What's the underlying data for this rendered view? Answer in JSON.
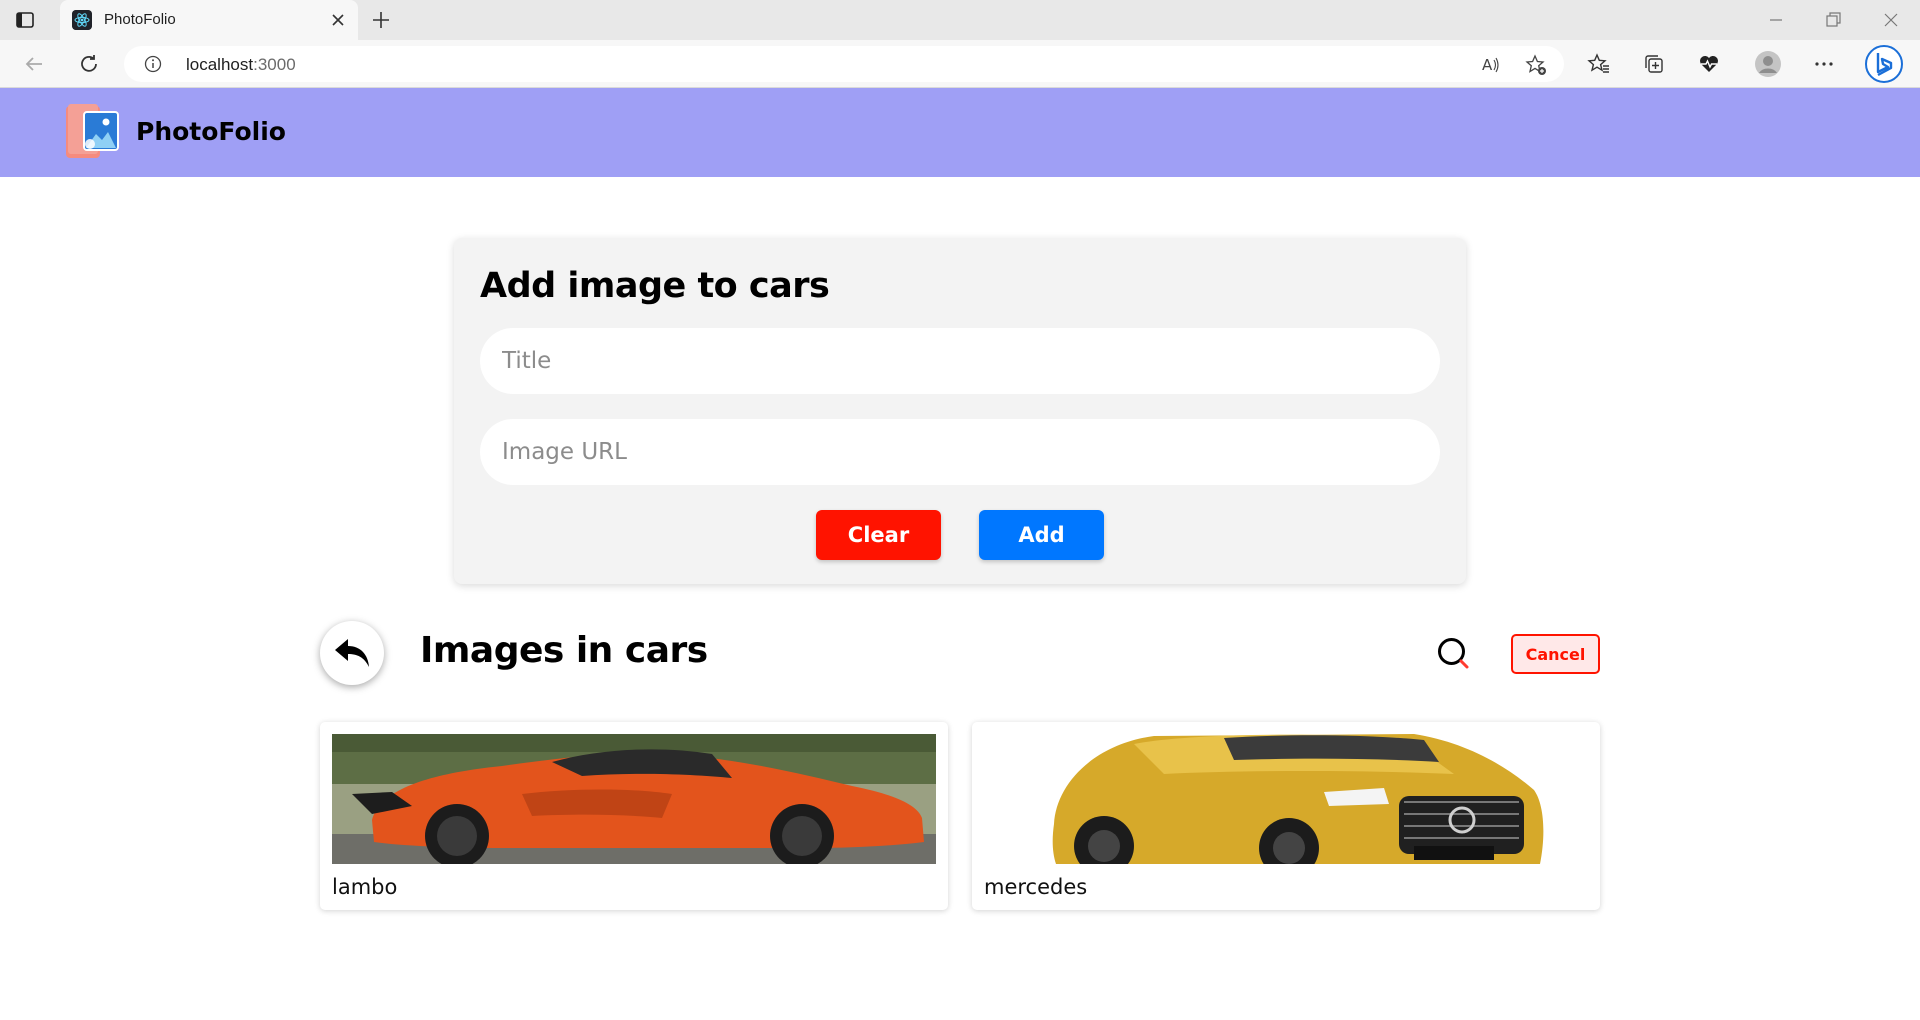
{
  "browser": {
    "tab_title": "PhotoFolio",
    "url_host": "localhost",
    "url_port": ":3000",
    "icons": [
      "sidebar-icon",
      "react-favicon-icon",
      "close-icon",
      "plus-icon",
      "minimize-icon",
      "restore-icon",
      "back-arrow-icon",
      "reload-icon",
      "info-icon",
      "read-aloud-icon",
      "add-favorite-icon",
      "favorites-icon",
      "collections-icon",
      "health-icon",
      "profile-icon",
      "more-icon",
      "bing-icon"
    ]
  },
  "header": {
    "title": "PhotoFolio",
    "bg_color": "#9f9ff5"
  },
  "form": {
    "heading": "Add image to cars",
    "title_placeholder": "Title",
    "url_placeholder": "Image URL",
    "clear_label": "Clear",
    "add_label": "Add",
    "clear_color": "#ff1300",
    "add_color": "#0077ff"
  },
  "images_section": {
    "title": "Images in cars",
    "cancel_label": "Cancel",
    "items": [
      {
        "caption": "lambo",
        "image": "orange sports car"
      },
      {
        "caption": "mercedes",
        "image": "yellow mercedes amg"
      }
    ]
  }
}
